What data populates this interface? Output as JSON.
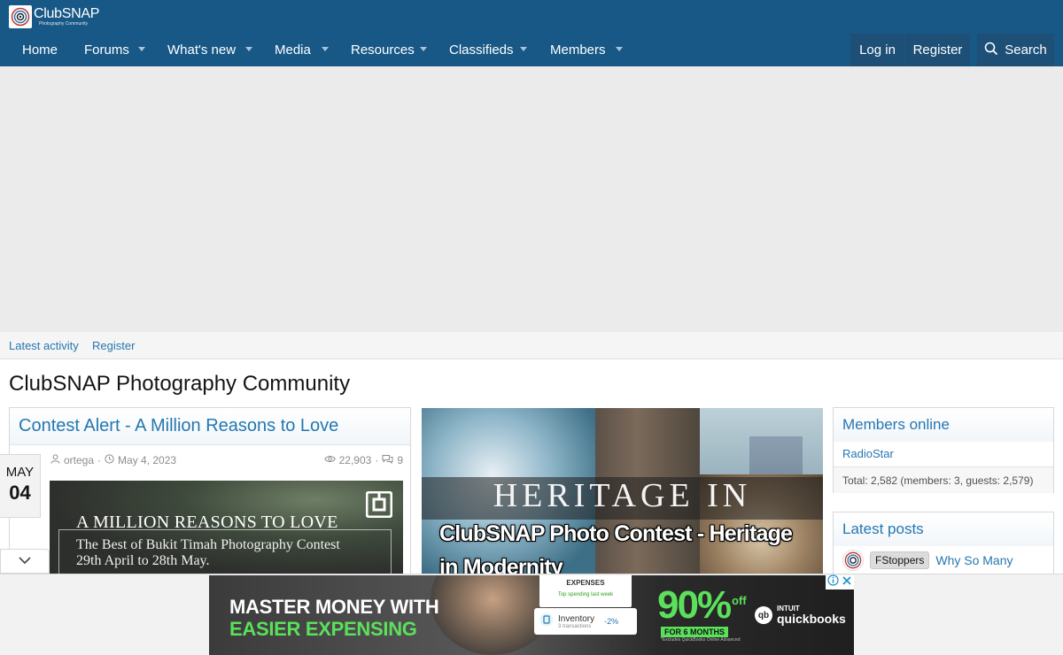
{
  "header": {
    "logo_name": "ClubSNAP",
    "logo_tagline": "Photography Community",
    "logo_icon": "camera-lens-logo-icon",
    "colors": {
      "header_bg": "#185886",
      "link": "#2577b1"
    }
  },
  "nav": {
    "items": [
      {
        "label": "Home",
        "has_dropdown": false
      },
      {
        "label": "Forums",
        "has_dropdown": true
      },
      {
        "label": "What's new",
        "has_dropdown": true
      },
      {
        "label": "Media",
        "has_dropdown": true
      },
      {
        "label": "Resources",
        "has_dropdown": true
      },
      {
        "label": "Classifieds",
        "has_dropdown": true
      },
      {
        "label": "Members",
        "has_dropdown": true
      }
    ],
    "login_label": "Log in",
    "register_label": "Register",
    "search_label": "Search",
    "search_icon": "search-icon"
  },
  "subnav": {
    "links": [
      {
        "label": "Latest activity"
      },
      {
        "label": "Register"
      }
    ]
  },
  "page": {
    "title": "ClubSNAP Photography Community"
  },
  "article": {
    "title": "Contest Alert - A Million Reasons to Love",
    "date_month": "MAY",
    "date_day": "04",
    "author": "ortega",
    "date": "May 4, 2023",
    "views": "22,903",
    "replies": "9",
    "image": {
      "line1": "A MILLION REASONS TO LOVE",
      "line2": "The Best of Bukit Timah Photography Contest",
      "line3": "29th April to 28th May."
    }
  },
  "feature": {
    "banner_text": "HERITAGE IN",
    "caption": "ClubSNAP Photo Contest - Heritage in Modernity"
  },
  "sidebar": {
    "members_online": {
      "title": "Members online",
      "members": [
        "RadioStar"
      ],
      "total": "Total: 2,582 (members: 3, guests: 2,579)"
    },
    "latest_posts": {
      "title": "Latest posts",
      "items": [
        {
          "prefix": "FStoppers",
          "title": "Why So Many"
        }
      ]
    }
  },
  "bottom_ad": {
    "headline1": "MASTER MONEY WITH",
    "headline2": "EASIER EXPENSING",
    "card_title": "EXPENSES",
    "card_sub": "Top spending last week",
    "inventory_name": "Inventory",
    "inventory_sub": "3 transactions",
    "inventory_pct": "-2%",
    "offer_big": "90%",
    "offer_off": "off",
    "offer_term": "FOR 6 MONTHS",
    "fine_print": "*Excludes QuickBooks Online Advanced",
    "brand_intuit": "INTUIT",
    "brand_name": "quickbooks",
    "brand_icon_text": "qb",
    "colors": {
      "accent": "#5be05b"
    }
  }
}
